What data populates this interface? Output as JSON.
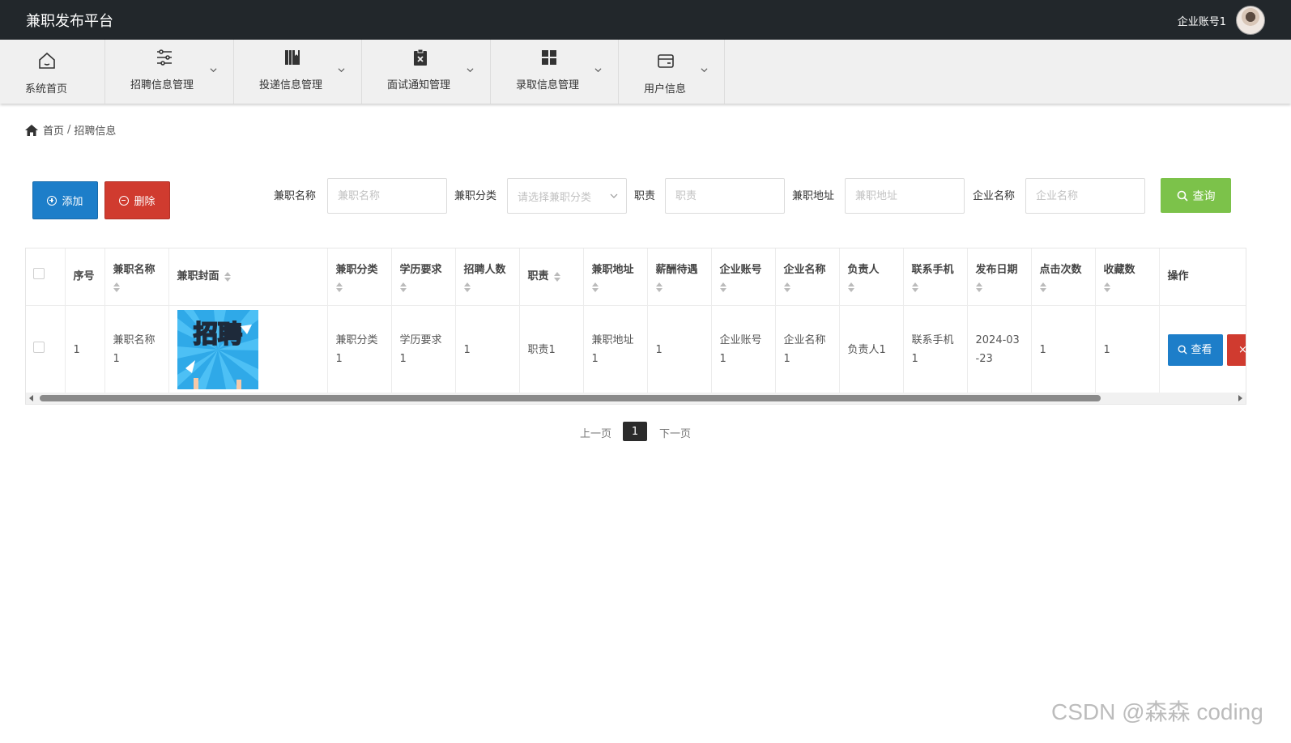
{
  "app": {
    "title": "兼职发布平台",
    "account": "企业账号1"
  },
  "nav": {
    "items": [
      {
        "label": "系统首页",
        "icon": "home-icon"
      },
      {
        "label": "招聘信息管理",
        "icon": "sliders-icon"
      },
      {
        "label": "投递信息管理",
        "icon": "books-icon"
      },
      {
        "label": "面试通知管理",
        "icon": "clipboard-x-icon"
      },
      {
        "label": "录取信息管理",
        "icon": "grid-icon"
      },
      {
        "label": "用户信息",
        "icon": "card-icon"
      }
    ]
  },
  "breadcrumb": {
    "home": "首页",
    "separator": "/",
    "current": "招聘信息"
  },
  "actions": {
    "add": "添加",
    "delete": "删除",
    "query": "查询"
  },
  "search": {
    "fields": [
      {
        "label": "兼职名称",
        "placeholder": "兼职名称"
      },
      {
        "label": "兼职分类",
        "placeholder": "请选择兼职分类"
      },
      {
        "label": "职责",
        "placeholder": "职责"
      },
      {
        "label": "兼职地址",
        "placeholder": "兼职地址"
      },
      {
        "label": "企业名称",
        "placeholder": "企业名称"
      }
    ]
  },
  "table": {
    "headers": [
      "序号",
      "兼职名称",
      "兼职封面",
      "兼职分类",
      "学历要求",
      "招聘人数",
      "职责",
      "兼职地址",
      "薪酬待遇",
      "企业账号",
      "企业名称",
      "负责人",
      "联系手机",
      "发布日期",
      "点击次数",
      "收藏数",
      "操作"
    ],
    "rows": [
      {
        "index": "1",
        "name": "兼职名称1",
        "cover_text": "招聘",
        "category": "兼职分类1",
        "education": "学历要求1",
        "headcount": "1",
        "duty": "职责1",
        "address": "兼职地址1",
        "salary": "1",
        "company_account": "企业账号1",
        "company_name": "企业名称1",
        "manager": "负责人1",
        "phone": "联系手机1",
        "date": "2024-03-23",
        "clicks": "1",
        "favorites": "1",
        "view_label": "查看",
        "delete_label": "×"
      }
    ]
  },
  "pagination": {
    "prev": "上一页",
    "current": "1",
    "next": "下一页"
  },
  "watermark": "CSDN @森森 coding",
  "colors": {
    "header": "#22272b",
    "primary": "#1d7ec9",
    "danger": "#d03b2f",
    "success": "#7cc24a"
  }
}
